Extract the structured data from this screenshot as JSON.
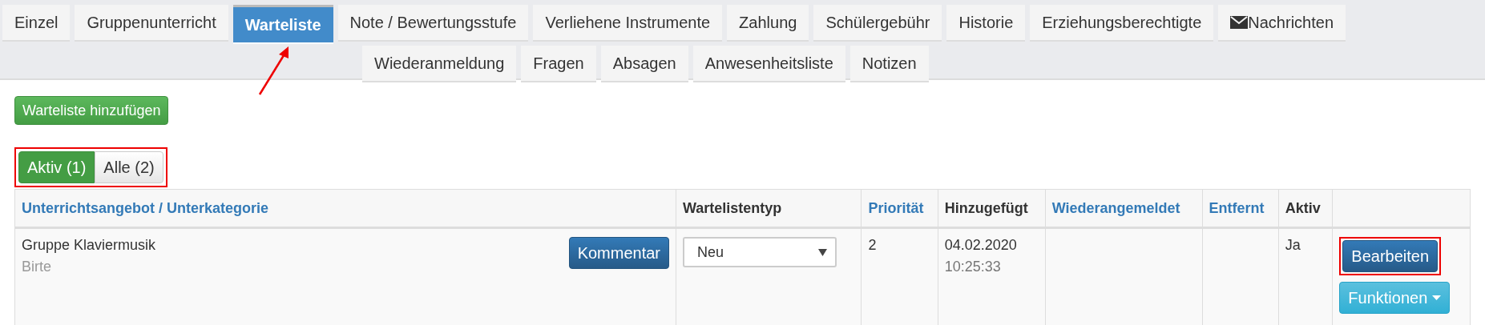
{
  "tab_rows": [
    [
      {
        "label": "Einzel",
        "selected": false
      },
      {
        "label": "Gruppenunterricht",
        "selected": false
      },
      {
        "label": "Warteliste",
        "selected": true
      },
      {
        "label": "Note / Bewertungsstufe",
        "selected": false
      },
      {
        "label": "Verliehene Instrumente",
        "selected": false
      },
      {
        "label": "Zahlung",
        "selected": false
      },
      {
        "label": "Schülergebühr",
        "selected": false
      },
      {
        "label": "Historie",
        "selected": false
      },
      {
        "label": "Erziehungsberechtigte",
        "selected": false
      },
      {
        "label": "Nachrichten",
        "selected": false,
        "kind": "mail"
      }
    ],
    [
      {
        "label": "Wiederanmeldung",
        "selected": false
      },
      {
        "label": "Fragen",
        "selected": false
      },
      {
        "label": "Absagen",
        "selected": false
      },
      {
        "label": "Anwesenheitsliste",
        "selected": false
      },
      {
        "label": "Notizen",
        "selected": false
      }
    ]
  ],
  "add_button": "Warteliste hinzufügen",
  "filters": [
    {
      "label": "Aktiv (1)",
      "selected": true
    },
    {
      "label": "Alle (2)",
      "selected": false
    }
  ],
  "table": {
    "columns": [
      {
        "label": "Unterrichtsangebot / Unterkategorie",
        "sortable": true
      },
      {
        "label": "Wartelistentyp",
        "sortable": false
      },
      {
        "label": "Priorität",
        "sortable": true
      },
      {
        "label": "Hinzugefügt",
        "sortable": false
      },
      {
        "label": "Wiederangemeldet",
        "sortable": true
      },
      {
        "label": "Entfernt",
        "sortable": true
      },
      {
        "label": "Aktiv",
        "sortable": false
      }
    ],
    "rows": [
      {
        "course": "Gruppe Klaviermusik",
        "subcategory": "Birte",
        "comment_button": "Kommentar",
        "type": "Neu",
        "priority": "2",
        "added_date": "04.02.2020",
        "added_time": "10:25:33",
        "active": "Ja",
        "edit_button": "Bearbeiten",
        "functions_button": "Funktionen"
      }
    ]
  }
}
